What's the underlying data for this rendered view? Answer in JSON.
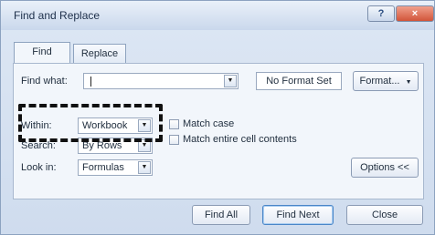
{
  "window": {
    "title": "Find and Replace",
    "help_glyph": "?",
    "close_glyph": "×"
  },
  "tabs": [
    {
      "label": "Find",
      "active": true
    },
    {
      "label": "Replace",
      "active": false
    }
  ],
  "find_what": {
    "label": "Find what:",
    "value": "",
    "format_status": "No Format Set",
    "format_button": "Format...",
    "dropdown_glyph": "▼"
  },
  "options": {
    "within": {
      "label": "Within:",
      "value": "Workbook"
    },
    "search": {
      "label": "Search:",
      "value": "By Rows"
    },
    "look_in": {
      "label": "Look in:",
      "value": "Formulas"
    },
    "match_case": {
      "label": "Match case",
      "checked": false
    },
    "match_entire": {
      "label": "Match entire cell contents",
      "checked": false
    },
    "options_button": "Options <<"
  },
  "footer": {
    "find_all": "Find All",
    "find_next": "Find Next",
    "close": "Close"
  },
  "colors": {
    "window_bg": "#d6e1f0",
    "panel_bg": "#f2f6fb",
    "close_button": "#d1553a",
    "highlight_border": "#111111"
  }
}
